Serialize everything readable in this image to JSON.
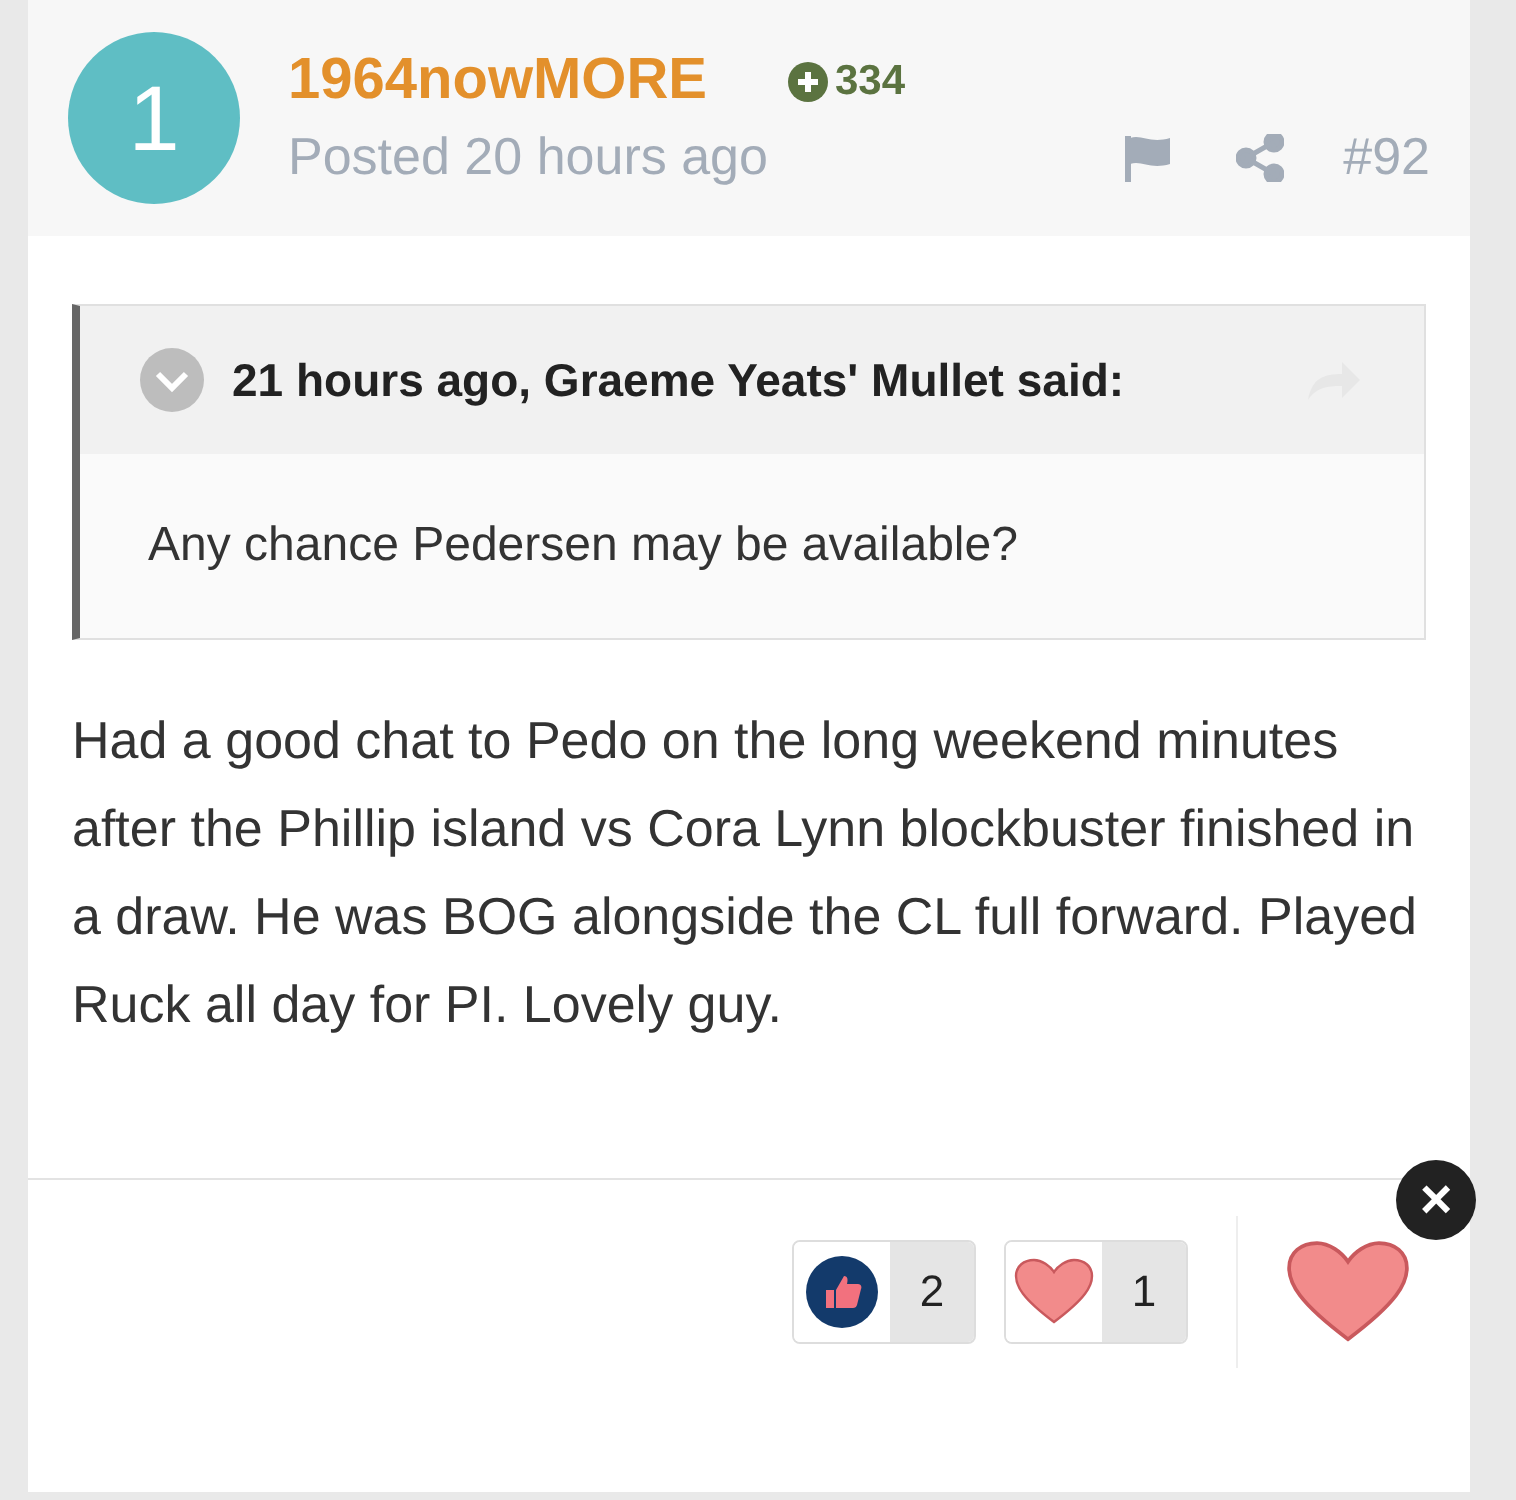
{
  "author": {
    "avatar_letter": "1",
    "name": "1964nowMORE",
    "reputation": "334",
    "posted": "Posted 20 hours ago",
    "post_number": "#92"
  },
  "quote": {
    "citation": "21 hours ago, Graeme Yeats' Mullet said:",
    "expanded": false,
    "text": "Any chance Pedersen may be available?"
  },
  "body": "Had a good chat to Pedo on the long weekend minutes after the Phillip island vs Cora Lynn blockbuster finished in a draw. He was BOG alongside the CL full forward. Played Ruck all day for PI. Lovely guy.",
  "reactions": [
    {
      "kind": "like",
      "count": "2"
    },
    {
      "kind": "love",
      "count": "1"
    }
  ],
  "close_label": "×"
}
